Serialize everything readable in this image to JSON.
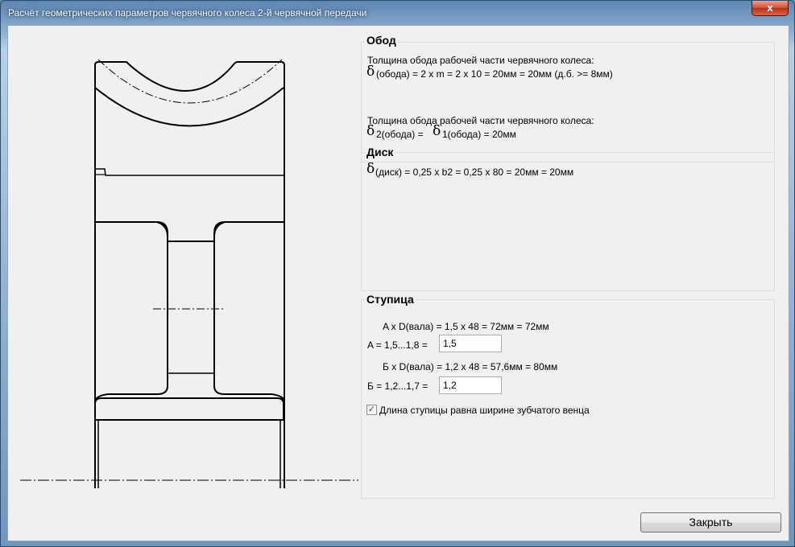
{
  "window": {
    "title": "Расчёт геометрических параметров червячного колеса 2-й червячной передачи",
    "close_glyph": "x"
  },
  "rim": {
    "title": "Обод",
    "line1": "Толщина обода рабочей части червячного колеса:",
    "delta": "δ",
    "line2": "(обода) = 2 x m = 2 x 10 = 20мм = 20мм    (д.б. >= 8мм)",
    "line3": "Толщина обода рабочей части червячного колеса:",
    "line4a": " 2(обода) = ",
    "line4b": "1(обода) = 20мм"
  },
  "disk": {
    "title": "Диск",
    "delta": "δ",
    "line1": "(диск) = 0,25 x b2 = 0,25 x 80 = 20мм = 20мм"
  },
  "hub": {
    "title": "Ступица",
    "a_formula": "A x D(вала) = 1,5 x 48 = 72мм = 72мм",
    "a_label": "A = 1,5...1,8 =",
    "a_value": "1,5",
    "b_formula": "Б x D(вала) = 1,2 x 48 = 57,6мм = 80мм",
    "b_label": "Б = 1,2...1,7 =",
    "b_value": "1,2",
    "checkbox_label": "Длина ступицы равна ширине зубчатого венца",
    "checkbox_checked": true,
    "check_glyph": "✓"
  },
  "footer": {
    "close_label": "Закрыть"
  },
  "colors": {
    "title_bar": "#7ea3c8",
    "panel_bg": "#f0f0f0",
    "close_red": "#c8432c"
  }
}
